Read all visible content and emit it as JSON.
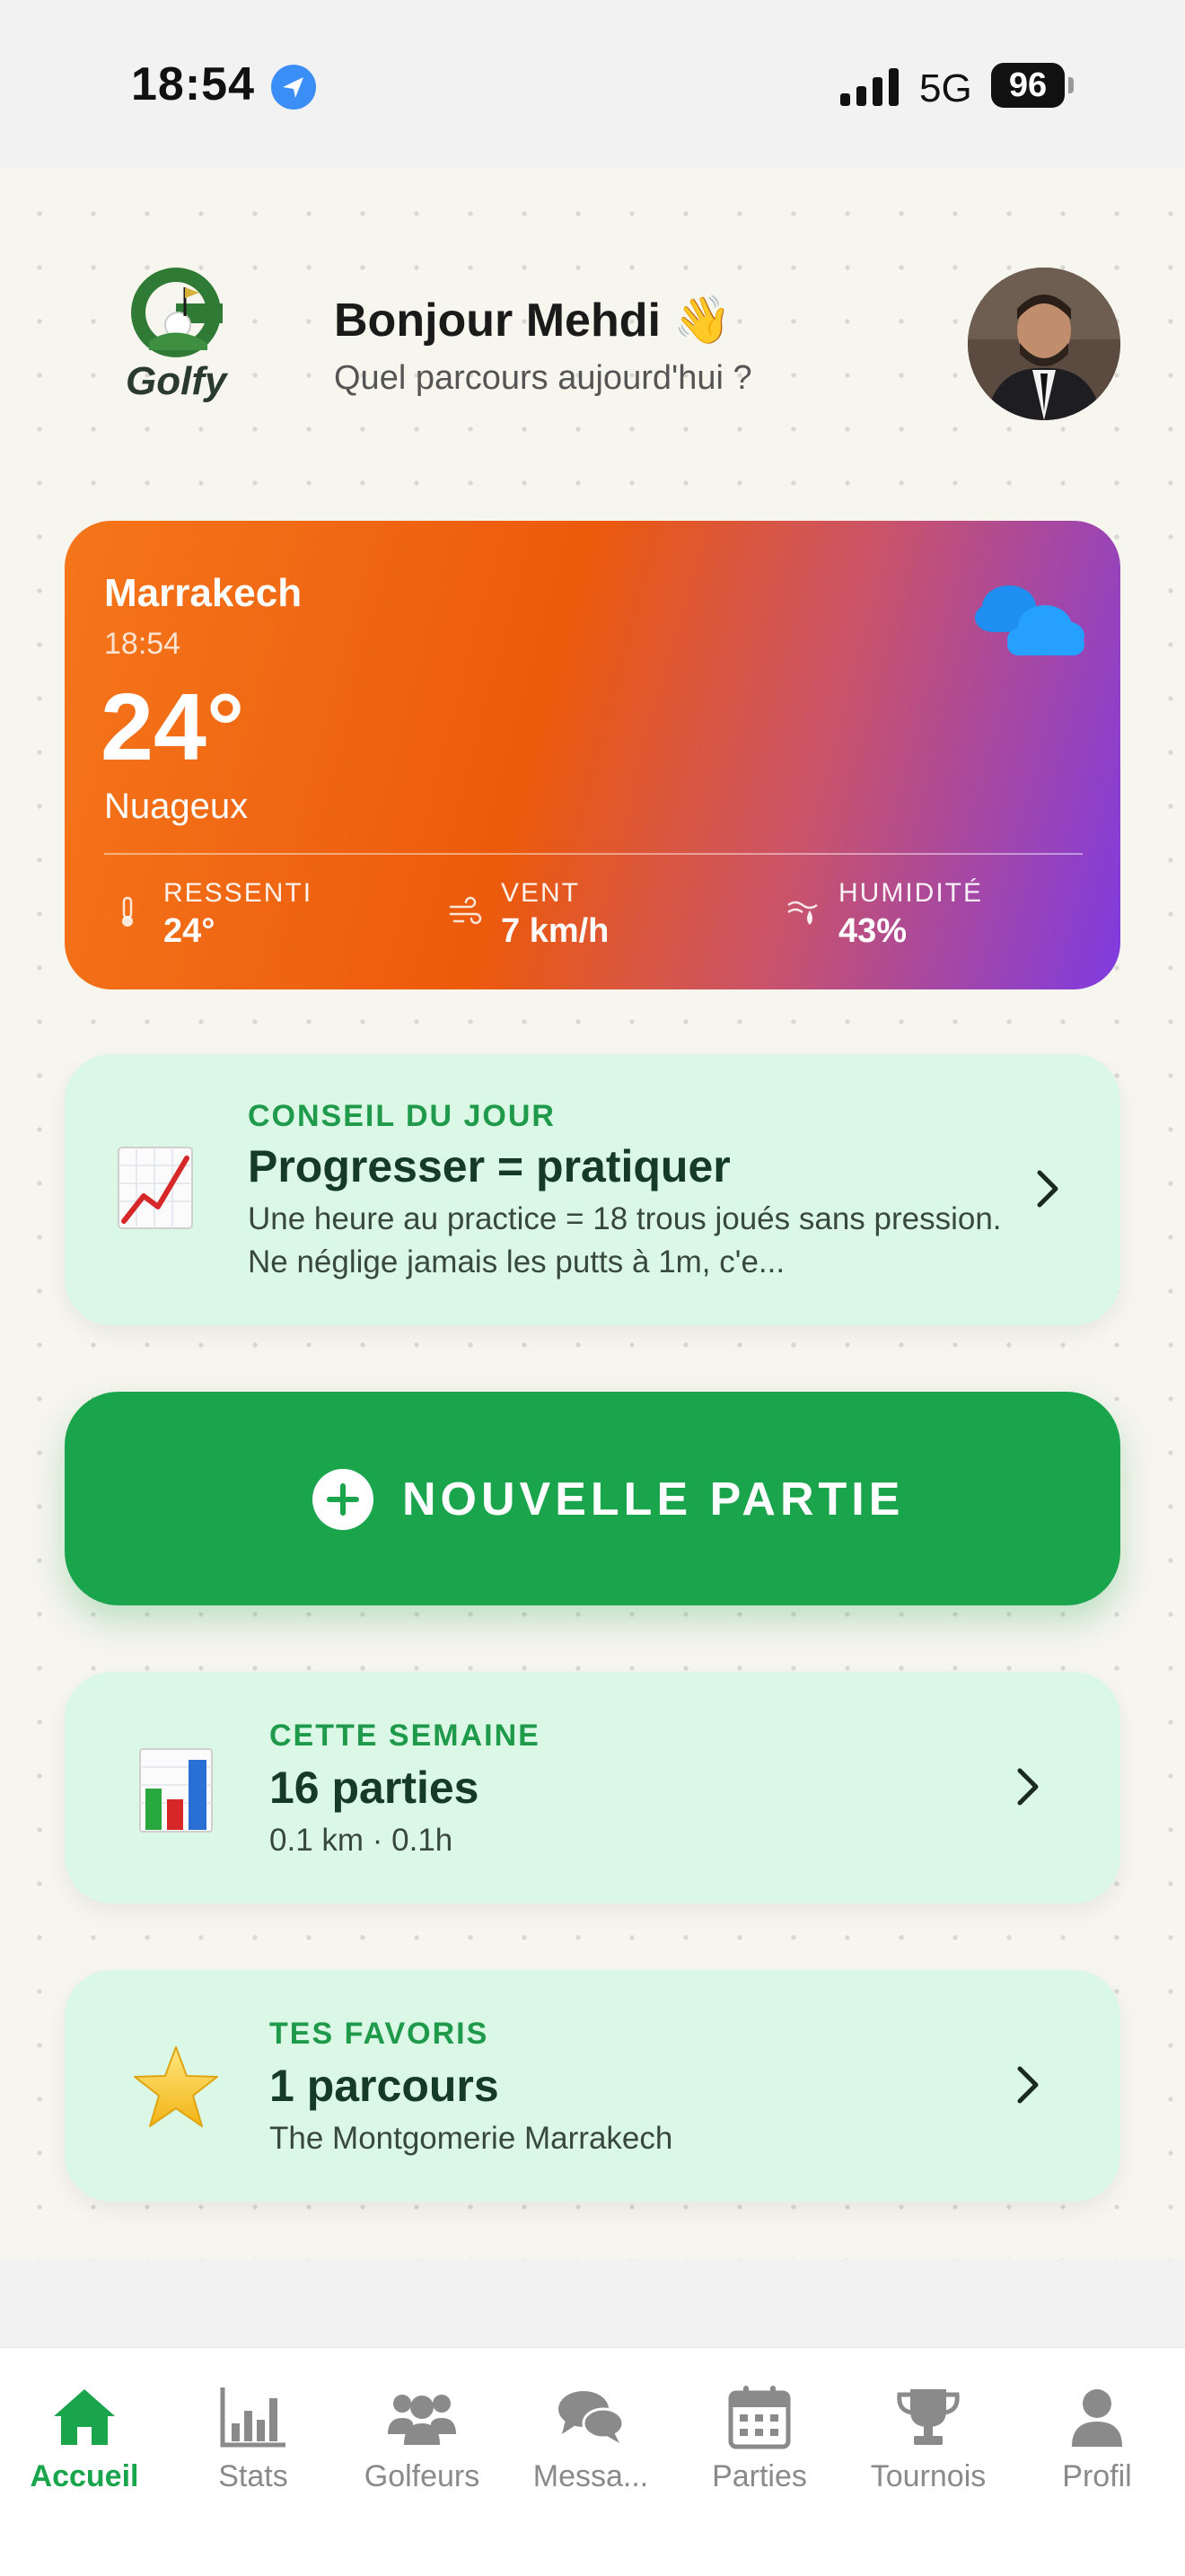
{
  "status_bar": {
    "time": "18:54",
    "network": "5G",
    "battery": "96"
  },
  "header": {
    "logo_text": "Golfy",
    "greeting": "Bonjour Mehdi 👋",
    "subtitle": "Quel parcours aujourd'hui ?"
  },
  "weather": {
    "city": "Marrakech",
    "time": "18:54",
    "temperature": "24°",
    "condition": "Nuageux",
    "feels_like_label": "RESSENTI",
    "feels_like_value": "24°",
    "wind_label": "VENT",
    "wind_value": "7 km/h",
    "humidity_label": "HUMIDITÉ",
    "humidity_value": "43%",
    "gradient_colors": [
      "#f5761b",
      "#ec5a0c",
      "#c9536b",
      "#7f3be0"
    ]
  },
  "tip_card": {
    "eyebrow": "CONSEIL DU JOUR",
    "title": "Progresser = pratiquer",
    "text": "Une heure au practice = 18 trous joués sans pression. Ne néglige jamais les putts à 1m, c'e...",
    "icon": "chart-increasing-icon"
  },
  "new_game": {
    "label": "NOUVELLE PARTIE",
    "color": "#1aa54c"
  },
  "week_card": {
    "eyebrow": "CETTE SEMAINE",
    "title": "16 parties",
    "subtitle": "0.1 km · 0.1h",
    "icon": "bar-chart-icon"
  },
  "favorites_card": {
    "eyebrow": "TES FAVORIS",
    "title": "1 parcours",
    "subtitle": "The Montgomerie Marrakech",
    "icon": "star-icon"
  },
  "tabbar": {
    "items": [
      {
        "label": "Accueil",
        "icon": "home-icon",
        "active": true
      },
      {
        "label": "Stats",
        "icon": "stats-icon",
        "active": false
      },
      {
        "label": "Golfeurs",
        "icon": "people-icon",
        "active": false
      },
      {
        "label": "Messa...",
        "icon": "messages-icon",
        "active": false
      },
      {
        "label": "Parties",
        "icon": "calendar-icon",
        "active": false
      },
      {
        "label": "Tournois",
        "icon": "trophy-icon",
        "active": false
      },
      {
        "label": "Profil",
        "icon": "profile-icon",
        "active": false
      }
    ],
    "active_color": "#1aa54c",
    "inactive_color": "#8a8a8a"
  }
}
